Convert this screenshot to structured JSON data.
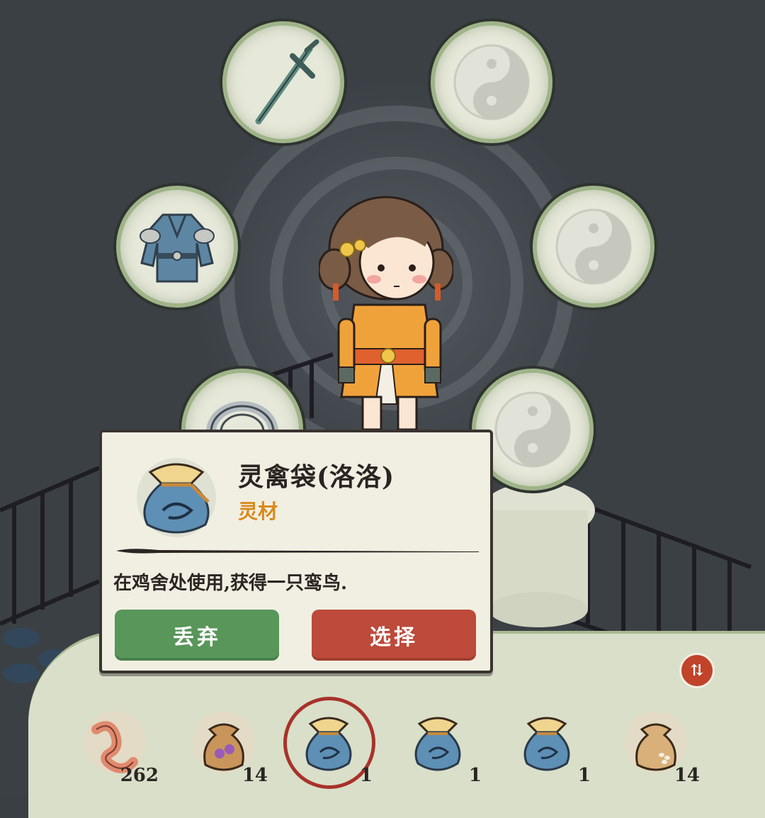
{
  "equipment_slots": {
    "weapon": {
      "icon": "sword-icon",
      "equipped": true
    },
    "armor": {
      "icon": "robe-armor-icon",
      "equipped": true
    },
    "accessory": {
      "icon": "ring-icon",
      "equipped": true
    },
    "slot_top_right": {
      "icon": "yin-yang-icon",
      "equipped": false
    },
    "slot_mid_right": {
      "icon": "yin-yang-icon",
      "equipped": false
    },
    "slot_low_right": {
      "icon": "yin-yang-icon",
      "equipped": false
    }
  },
  "tooltip": {
    "title": "灵禽袋(洛洛)",
    "type": "灵材",
    "description": "在鸡舍处使用,获得一只鸾鸟.",
    "discard_label": "丢弃",
    "select_label": "选择",
    "icon": "spirit-bird-bag-icon"
  },
  "inventory": {
    "sort_label": "⇅",
    "items": [
      {
        "icon": "worm-icon",
        "count": "262"
      },
      {
        "icon": "mushroom-bag-icon",
        "count": "14"
      },
      {
        "icon": "spirit-bird-bag-icon",
        "count": "1",
        "selected": true
      },
      {
        "icon": "spirit-bird-bag-icon",
        "count": "1"
      },
      {
        "icon": "spirit-bird-bag-icon",
        "count": "1"
      },
      {
        "icon": "seed-bag-icon",
        "count": "14"
      }
    ]
  },
  "colors": {
    "discard": "#58965a",
    "select": "#bd4a3a",
    "item_type": "#d98a1e",
    "selected_ring": "#a8322a"
  }
}
